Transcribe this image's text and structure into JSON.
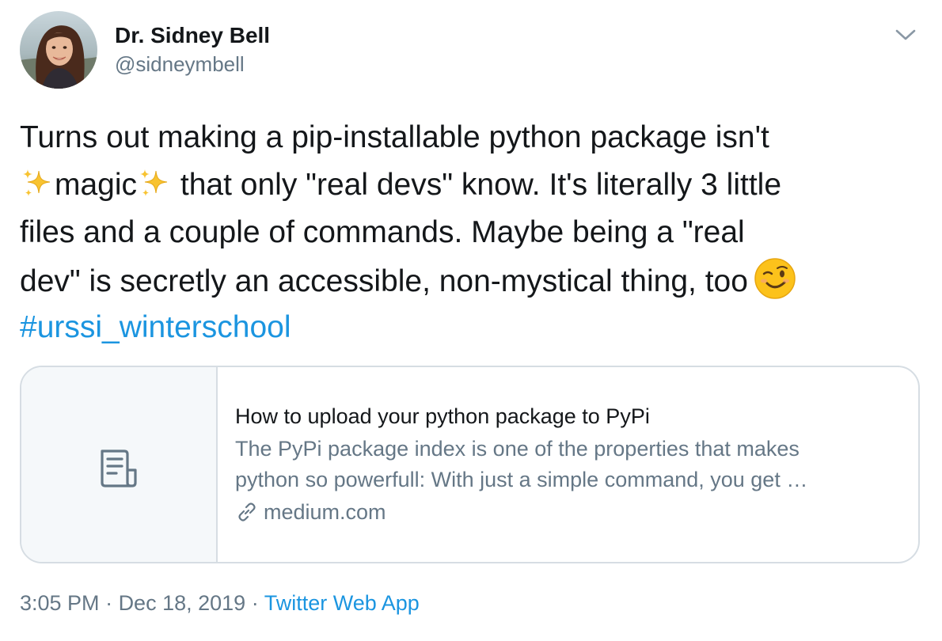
{
  "author": {
    "display_name": "Dr. Sidney Bell",
    "handle": "@sidneymbell"
  },
  "tweet": {
    "line1": "Turns out making a pip-installable python package isn't",
    "line2_word": "magic",
    "line2_rest": " that only \"real devs\" know. It's literally 3 little",
    "line3": "files and a couple of commands. Maybe being a \"real",
    "line4": "dev\" is secretly an accessible, non-mystical thing, too",
    "hashtag": "#urssi_winterschool",
    "emoji": [
      "sparkles",
      "sparkles",
      "winking-face"
    ]
  },
  "card": {
    "title": "How to upload your python package to PyPi",
    "description_line1": "The PyPi package index is one of the properties that makes",
    "description_line2": "python so powerfull: With just a simple command, you get …",
    "domain": "medium.com",
    "thumbnail_icon": "document-icon"
  },
  "footer": {
    "time": "3:05 PM",
    "sep1": " · ",
    "date": "Dec 18, 2019",
    "sep2": " · ",
    "source": "Twitter Web App"
  },
  "colors": {
    "text": "#14171a",
    "secondary": "#657786",
    "link": "#1b95e0",
    "border": "#d6dde3",
    "card_thumb_bg": "#f5f8fa"
  }
}
